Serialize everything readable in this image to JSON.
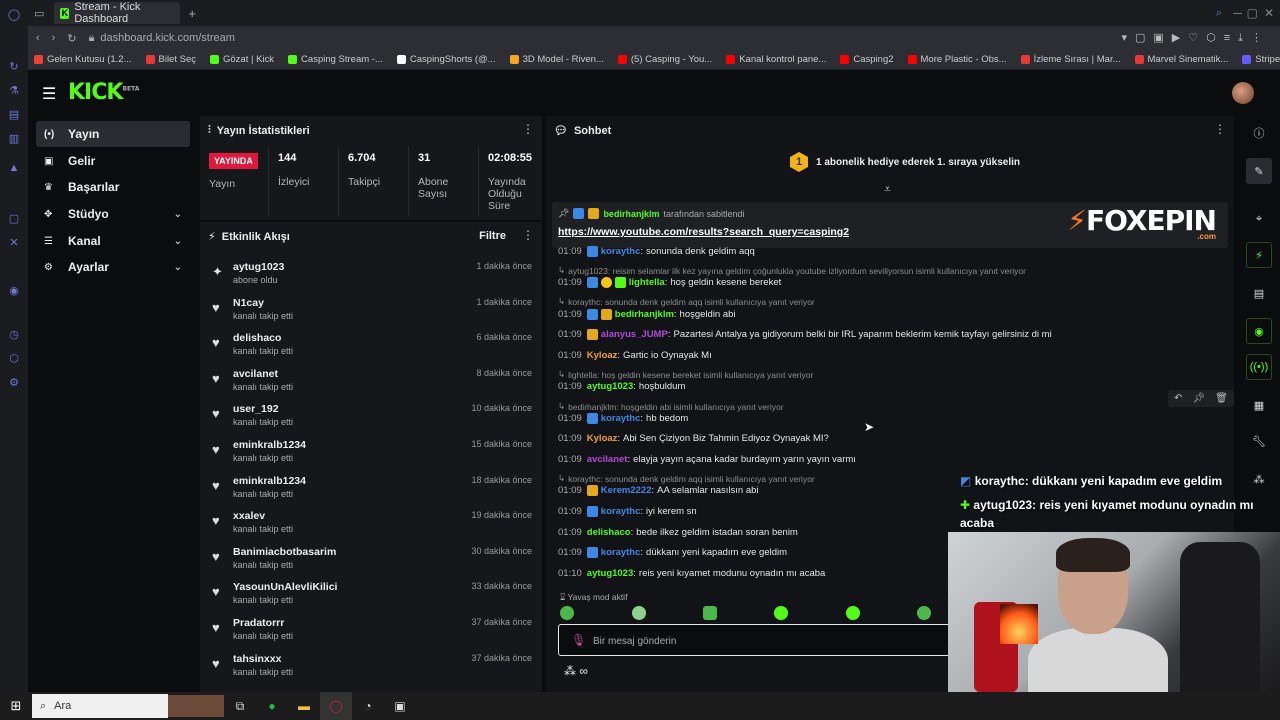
{
  "browser": {
    "tab_title": "Stream - Kick Dashboard",
    "new_tab": "+",
    "url": "dashboard.kick.com/stream",
    "bookmarks": [
      {
        "label": "Gelen Kutusu (1.2...",
        "color": "#ea4335"
      },
      {
        "label": "Bilet Seç",
        "color": "#e53935"
      },
      {
        "label": "Gözat | Kick",
        "color": "#53fc18"
      },
      {
        "label": "Casping Stream -...",
        "color": "#53fc18"
      },
      {
        "label": "CaspingShorts (@...",
        "color": "#ffffff"
      },
      {
        "label": "3D Model - Riven...",
        "color": "#f5a623"
      },
      {
        "label": "(5) Casping - You...",
        "color": "#ff0000"
      },
      {
        "label": "Kanal kontrol pane...",
        "color": "#ff0000"
      },
      {
        "label": "Casping2",
        "color": "#ff0000"
      },
      {
        "label": "More Plastic - Obs...",
        "color": "#ff0000"
      },
      {
        "label": "İzleme Sırası | Mar...",
        "color": "#e53935"
      },
      {
        "label": "Marvel Sinematik...",
        "color": "#e53935"
      },
      {
        "label": "Stripe Express",
        "color": "#635bff"
      }
    ]
  },
  "header": {
    "logo": "KICK",
    "logo_sup": "BETA"
  },
  "sidebar": {
    "items": [
      {
        "label": "Yayın",
        "icon": "broadcast-icon",
        "glyph": "(•)"
      },
      {
        "label": "Gelir",
        "icon": "wallet-icon",
        "glyph": "▣"
      },
      {
        "label": "Başarılar",
        "icon": "trophy-icon",
        "glyph": "♛"
      },
      {
        "label": "Stüdyo",
        "icon": "studio-icon",
        "glyph": "✥"
      },
      {
        "label": "Kanal",
        "icon": "channel-icon",
        "glyph": "☰"
      },
      {
        "label": "Ayarlar",
        "icon": "gear-icon",
        "glyph": "⚙"
      }
    ]
  },
  "stats": {
    "title": "Yayın İstatistikleri",
    "live_badge": "YAYINDA",
    "live_label": "Yayın",
    "items": [
      {
        "value": "144",
        "label": "İzleyici"
      },
      {
        "value": "6.704",
        "label": "Takipçi"
      },
      {
        "value": "31",
        "label": "Abone Sayısı"
      },
      {
        "value": "02:08:55",
        "label": "Yayında Olduğu Süre"
      }
    ]
  },
  "feed": {
    "title": "Etkinlik Akışı",
    "filter": "Filtre",
    "items": [
      {
        "name": "aytug1023",
        "sub": "abone oldu",
        "time": "1 dakika önce",
        "icon": "sparkle-icon",
        "glyph": "✦"
      },
      {
        "name": "N1cay",
        "sub": "kanalı takip etti",
        "time": "1 dakika önce",
        "icon": "heart-icon",
        "glyph": "♥"
      },
      {
        "name": "delishaco",
        "sub": "kanalı takip etti",
        "time": "6 dakika önce",
        "icon": "heart-icon",
        "glyph": "♥"
      },
      {
        "name": "avcilanet",
        "sub": "kanalı takip etti",
        "time": "8 dakika önce",
        "icon": "heart-icon",
        "glyph": "♥"
      },
      {
        "name": "user_192",
        "sub": "kanalı takip etti",
        "time": "10 dakika önce",
        "icon": "heart-icon",
        "glyph": "♥"
      },
      {
        "name": "eminkralb1234",
        "sub": "kanalı takip etti",
        "time": "15 dakika önce",
        "icon": "heart-icon",
        "glyph": "♥"
      },
      {
        "name": "eminkralb1234",
        "sub": "kanalı takip etti",
        "time": "18 dakika önce",
        "icon": "heart-icon",
        "glyph": "♥"
      },
      {
        "name": "xxalev",
        "sub": "kanalı takip etti",
        "time": "19 dakika önce",
        "icon": "heart-icon",
        "glyph": "♥"
      },
      {
        "name": "Banimiacbotbasarim",
        "sub": "kanalı takip etti",
        "time": "30 dakika önce",
        "icon": "heart-icon",
        "glyph": "♥"
      },
      {
        "name": "YasounUnAlevliKilici",
        "sub": "kanalı takip etti",
        "time": "33 dakika önce",
        "icon": "heart-icon",
        "glyph": "♥"
      },
      {
        "name": "Pradatorrr",
        "sub": "kanalı takip etti",
        "time": "37 dakika önce",
        "icon": "heart-icon",
        "glyph": "♥"
      },
      {
        "name": "tahsinxxx",
        "sub": "kanalı takip etti",
        "time": "37 dakika önce",
        "icon": "heart-icon",
        "glyph": "♥"
      }
    ]
  },
  "chat": {
    "title": "Sohbet",
    "sub_goal": "1 abonelik hediye ederek 1. sıraya yükselin",
    "sub_goal_rank": "1",
    "pinned_user": "bedirhanjklm",
    "pinned_suffix": "tarafından sabitlendi",
    "pinned_link": "https://www.youtube.com/results?search_query=casping2",
    "sponsor": "FOXEPIN",
    "sponsor_tld": ".com",
    "messages": [
      {
        "kind": "msg",
        "time": "01:09",
        "user": "koraythc",
        "color": "#3d87e5",
        "badges": [
          "blue"
        ],
        "text": "sonunda denk geldim aqq"
      },
      {
        "kind": "reply",
        "text": "aytug1023: reisim selamlar ilk kez yayına geldim çoğunlukla youtube izliyordum seviliyorsun isimli kullanıcıya yanıt veriyor"
      },
      {
        "kind": "msg",
        "time": "01:09",
        "user": "lightella",
        "color": "#53fc18",
        "badges": [
          "blue",
          "yel",
          "green"
        ],
        "text": "hoş geldin kesene bereket"
      },
      {
        "kind": "reply",
        "text": "koraythc: sonunda denk geldim aqq isimli kullanıcıya yanıt veriyor"
      },
      {
        "kind": "msg",
        "time": "01:09",
        "user": "bedirhanjklm",
        "color": "#53fc18",
        "badges": [
          "blue",
          "gold"
        ],
        "text": "hoşgeldin abi"
      },
      {
        "kind": "msg",
        "time": "01:09",
        "user": "alanyus_JUMP",
        "color": "#b14ad9",
        "badges": [
          "gold"
        ],
        "text": "Pazartesi Antalya ya gidiyorum belki bir IRL yaparım beklerim kemik tayfayı gelirsiniz di mi"
      },
      {
        "kind": "msg",
        "time": "01:09",
        "user": "Kyloaz",
        "color": "#f0a030",
        "badges": [],
        "text": "Gartic io Oynayak Mı"
      },
      {
        "kind": "reply",
        "text": "lightella: hoş geldin kesene bereket isimli kullanıcıya yanıt veriyor"
      },
      {
        "kind": "msg",
        "time": "01:09",
        "user": "aytug1023",
        "color": "#53fc18",
        "badges": [],
        "text": "hoşbuldum"
      },
      {
        "kind": "reply",
        "text": "bedirhanjklm: hoşgeldin abi isimli kullanıcıya yanıt veriyor"
      },
      {
        "kind": "msg",
        "time": "01:09",
        "user": "koraythc",
        "color": "#3d87e5",
        "badges": [
          "blue"
        ],
        "text": "hb bedom"
      },
      {
        "kind": "msg",
        "time": "01:09",
        "user": "Kyloaz",
        "color": "#f0a030",
        "badges": [],
        "text": "Abi Sen Çiziyon Biz Tahmin Ediyoz Oynayak MI?"
      },
      {
        "kind": "msg",
        "time": "01:09",
        "user": "avcilanet",
        "color": "#b14ad9",
        "badges": [],
        "text": "elayja yayın açana kadar burdayım yarın yayın varmı"
      },
      {
        "kind": "reply",
        "text": "koraythc: sonunda denk geldim aqq isimli kullanıcıya yanıt veriyor"
      },
      {
        "kind": "msg",
        "time": "01:09",
        "user": "Kerem2222",
        "color": "#3d87e5",
        "badges": [
          "gold"
        ],
        "text": "AA selamlar nasılsın abi"
      },
      {
        "kind": "msg",
        "time": "01:09",
        "user": "koraythc",
        "color": "#3d87e5",
        "badges": [
          "blue"
        ],
        "text": "iyi kerem sn"
      },
      {
        "kind": "msg",
        "time": "01:09",
        "user": "delishaco",
        "color": "#53fc18",
        "badges": [],
        "text": "bede ilkez geldim istadan soran benim"
      },
      {
        "kind": "msg",
        "time": "01:09",
        "user": "koraythc",
        "color": "#3d87e5",
        "badges": [
          "blue"
        ],
        "text": "dükkanı yeni kapadım eve geldim"
      },
      {
        "kind": "msg",
        "time": "01:10",
        "user": "aytug1023",
        "color": "#53fc18",
        "badges": [],
        "text": "reis yeni kıyamet modunu oynadın mı acaba"
      }
    ],
    "slow_mode": "Yavaş mod aktif",
    "placeholder": "Bir mesaj gönderin"
  },
  "overlay": {
    "line1_user": "koraythc",
    "line1_text": ": dükkanı yeni kapadım eve geldim",
    "line2_user": "aytug1023",
    "line2_text": ": reis yeni kıyamet modunu oynadın mı acaba"
  },
  "taskbar": {
    "search": "Ara"
  }
}
